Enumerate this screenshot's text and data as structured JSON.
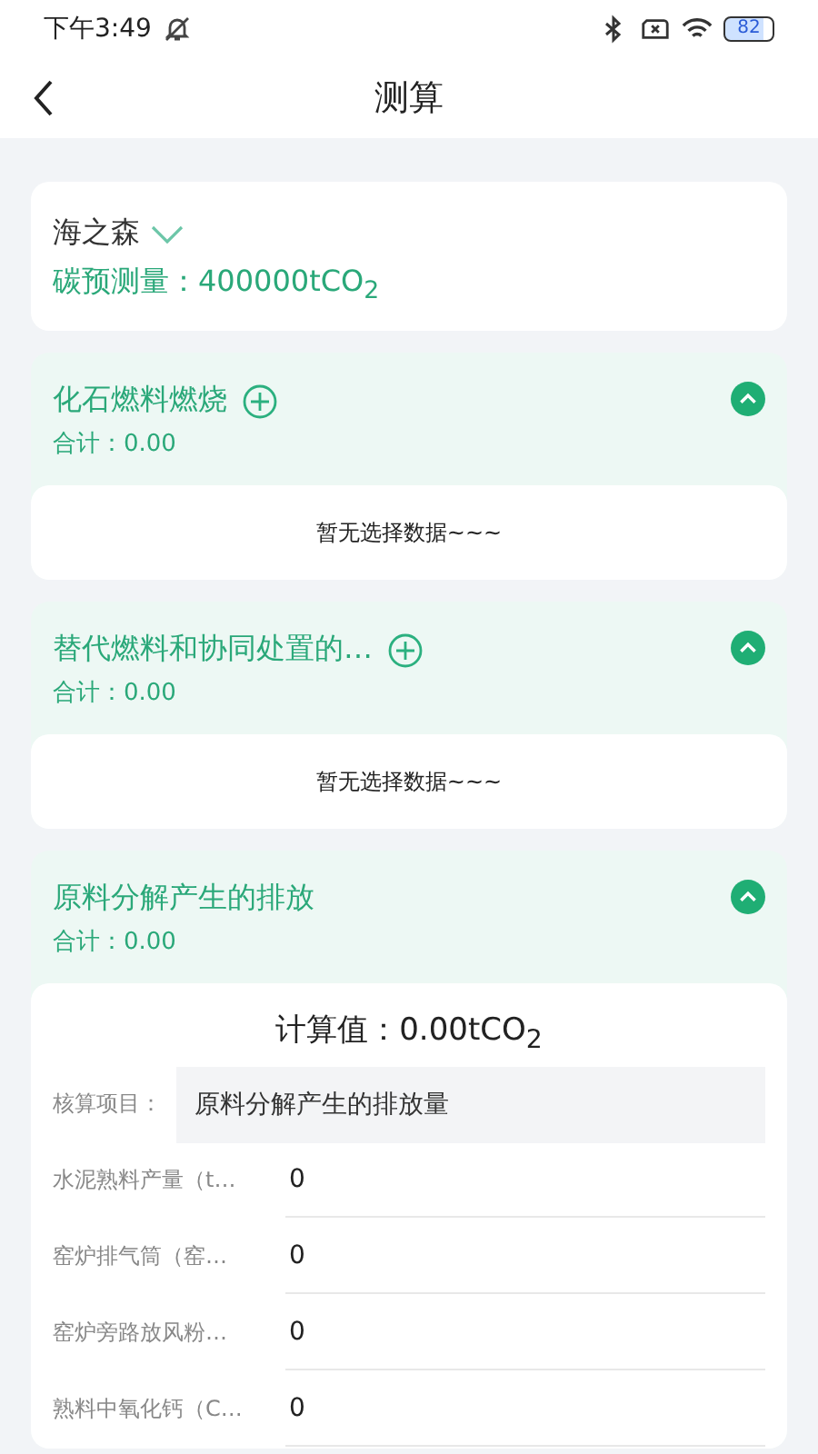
{
  "status_bar": {
    "time": "下午3:49",
    "battery": "82"
  },
  "header": {
    "title": "测算"
  },
  "summary": {
    "company": "海之森",
    "estimate": "碳预测量：400000tCO$_{2}$"
  },
  "sections": [
    {
      "title": "化石燃料燃烧",
      "has_add": true,
      "expanded": true,
      "total": "合计：0.00",
      "kind": "empty",
      "empty_text": "暂无选择数据~~~"
    },
    {
      "title": "替代燃料和协同处置的…",
      "has_add": true,
      "expanded": true,
      "total": "合计：0.00",
      "kind": "empty",
      "empty_text": "暂无选择数据~~~"
    },
    {
      "title": "原料分解产生的排放",
      "has_add": false,
      "expanded": true,
      "total": "合计：0.00",
      "kind": "form",
      "calc": "计算值：0.00tCO$_{2}$",
      "item_label": "核算项目：",
      "item_value": "原料分解产生的排放量",
      "fields": [
        {
          "label": "水泥熟料产量（t…",
          "value": "0"
        },
        {
          "label": "窑炉排气筒（窑…",
          "value": "0"
        },
        {
          "label": "窑炉旁路放风粉…",
          "value": "0"
        },
        {
          "label": "熟料中氧化钙（C…",
          "value": "0"
        }
      ]
    }
  ]
}
